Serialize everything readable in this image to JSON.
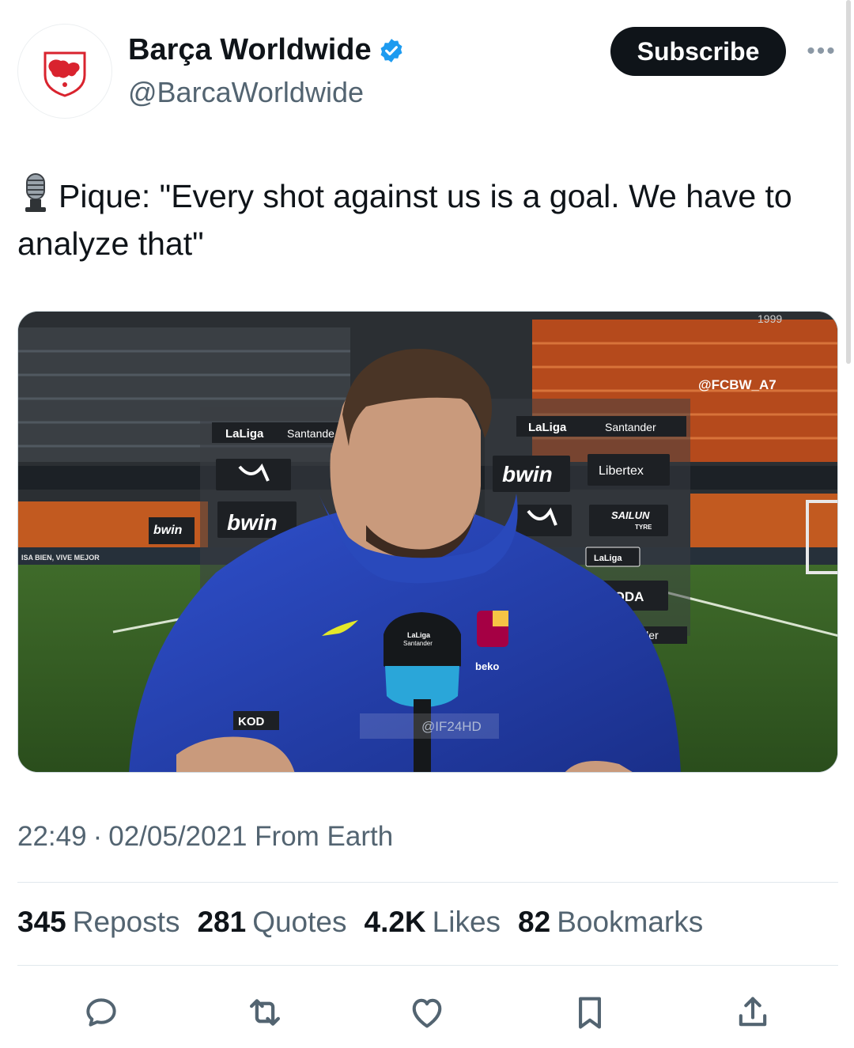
{
  "account": {
    "display_name": "Barça Worldwide",
    "handle": "@BarcaWorldwide",
    "verified": true,
    "subscribe_label": "Subscribe",
    "more_label": "•••"
  },
  "tweet": {
    "text": "Pique: \"Every shot against us is a goal. We have to analyze that\"",
    "emoji": "microphone-icon"
  },
  "media": {
    "watermark_top": "@FCBW_A7",
    "watermark_bottom": "@IF24HD",
    "boards": {
      "laliga_santander_1": "LaLiga",
      "santander_1": "Santande",
      "laliga_santander_2": "LaLiga",
      "santander_2": "Santander",
      "bwin": "bwin",
      "libertex": "Libertex",
      "sailun": "SAILUN",
      "sailun_sub": "TYRE",
      "skoda": "ŠKODA",
      "laliga_small": "LaLiga",
      "tander": "tander",
      "year": "1999",
      "ad_strip": "ISA BIEN, VIVE MEJOR",
      "mic_text_1": "LaLiga",
      "mic_text_2": "Santander",
      "beko": "beko",
      "kod": "KOD"
    }
  },
  "meta": {
    "time": "22:49",
    "separator": "·",
    "date": "02/05/2021",
    "source": "From Earth"
  },
  "stats": [
    {
      "count": "345",
      "label": "Reposts"
    },
    {
      "count": "281",
      "label": "Quotes"
    },
    {
      "count": "4.2K",
      "label": "Likes"
    },
    {
      "count": "82",
      "label": "Bookmarks"
    }
  ],
  "actions": [
    "reply-icon",
    "repost-icon",
    "like-icon",
    "bookmark-icon",
    "share-icon"
  ],
  "colors": {
    "verified_blue": "#1d9bf0",
    "text_primary": "#0f1419",
    "text_secondary": "#536471",
    "jacket_blue": "#2340b5"
  }
}
